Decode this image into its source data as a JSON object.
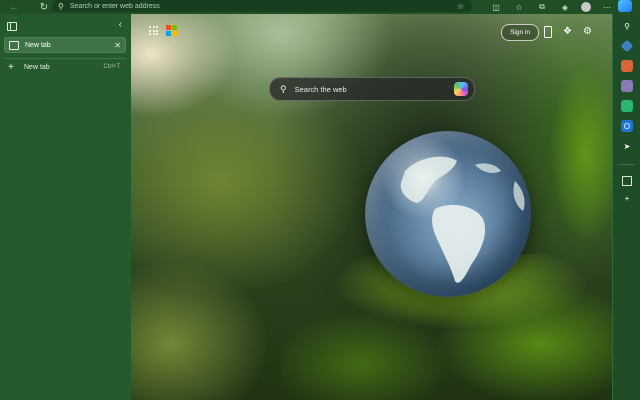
{
  "browser": {
    "address_placeholder": "Search or enter web address",
    "toolbar_icons": [
      "back-icon",
      "refresh-icon",
      "star-icon",
      "reading-view-icon",
      "favorites-icon",
      "collections-icon",
      "extensions-icon",
      "profile-avatar",
      "more-icon"
    ]
  },
  "sidebar": {
    "tabs": [
      {
        "label": "New tab",
        "active": true
      }
    ],
    "new_tab_label": "New tab",
    "new_tab_shortcut": "Ctrl+T"
  },
  "newtab_page": {
    "sign_in_label": "Sign in",
    "search_placeholder": "Search the web",
    "logo_colors": [
      "#f25022",
      "#7fba00",
      "#00a4ef",
      "#ffb900"
    ]
  },
  "right_sidebar": {
    "items": [
      "search-icon",
      "shopping-icon",
      "tools-icon",
      "games-icon",
      "microsoft365-icon",
      "outlook-icon",
      "telegram-icon",
      "add-icon"
    ]
  },
  "colors": {
    "theme_green": "#245a2e",
    "frame_green": "#1e4d28"
  }
}
